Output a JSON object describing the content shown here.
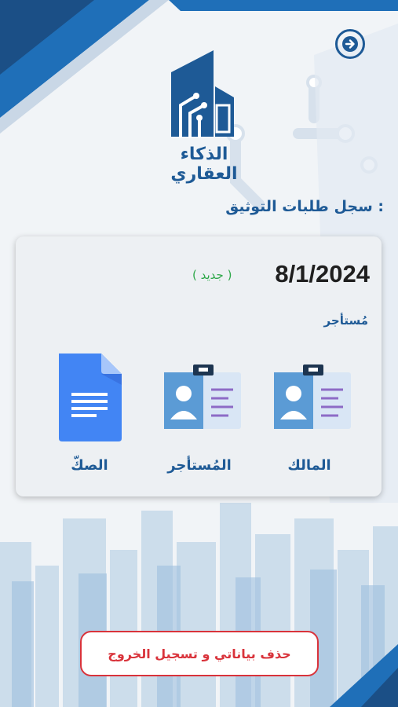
{
  "app": {
    "name": "الذكاء العقاري"
  },
  "section": {
    "title": ": سجل طلبات التوثيق"
  },
  "request": {
    "date": "8/1/2024",
    "status": "( جديد )",
    "role": "مُستأجر"
  },
  "documents": [
    {
      "label": "المالك",
      "icon": "id-card-icon"
    },
    {
      "label": "المُستأجر",
      "icon": "id-card-icon"
    },
    {
      "label": "الصكّ",
      "icon": "document-icon"
    }
  ],
  "actions": {
    "logout_label": "حذف بياناتي و تسجيل الخروج"
  },
  "colors": {
    "primary": "#1e5a96",
    "status_new": "#2fa84a",
    "danger": "#d9333b",
    "doc_blue": "#4285f4",
    "card_blue": "#5b9bd5"
  }
}
